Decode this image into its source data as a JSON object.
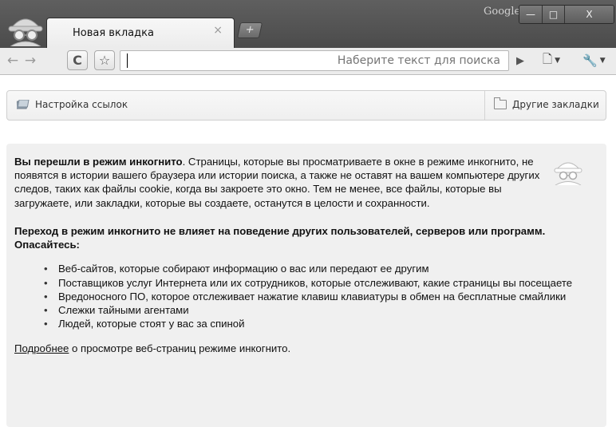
{
  "tab": {
    "title": "Новая вкладка",
    "close_glyph": "×",
    "newtab_glyph": "+"
  },
  "titlebar": {
    "brand": "Google",
    "min_glyph": "—",
    "max_glyph": "□",
    "close_glyph": "X"
  },
  "toolbar": {
    "back_glyph": "←",
    "forward_glyph": "→",
    "reload_glyph": "C",
    "star_glyph": "☆",
    "omnibox_placeholder": "Наберите текст для поиска",
    "go_glyph": "▶",
    "page_glyph": "🗋",
    "tools_glyph": "🔧",
    "dropdown_glyph": "▼"
  },
  "bookmarks": {
    "setup_label": "Настройка ссылок",
    "other_label": "Другие закладки"
  },
  "content": {
    "intro_bold": "Вы перешли в режим инкогнито",
    "intro_text": ". Страницы, которые вы просматриваете в окне в режиме инкогнито, не появятся в истории вашего браузера или истории поиска, а также не оставят на вашем компьютере других следов, таких как файлы cookie, когда вы закроете это окно. Тем не менее, все файлы, которые вы загружаете, или закладки, которые вы создаете, останутся в целости и сохранности.",
    "warning_heading": "Переход в режим инкогнито не влияет на поведение других пользователей, серверов или программ. Опасайтесь:",
    "threats": [
      "Веб-сайтов, которые собирают информацию о вас или передают ее другим",
      "Поставщиков услуг Интернета или их сотрудников, которые отслеживают, какие страницы вы посещаете",
      "Вредоносного ПО, которое отслеживает нажатие клавиш клавиатуры в обмен на бесплатные смайлики",
      "Слежки тайными агентами",
      "Людей, которые стоят у вас за спиной"
    ],
    "more_link": "Подробнее",
    "more_text": " о просмотре веб-страниц режиме инкогнито."
  },
  "colors": {
    "titlebar": "#555555",
    "toolbar": "#ececec",
    "content_bg": "#f0f0f0"
  },
  "icons": [
    "incognito-icon",
    "back-icon",
    "forward-icon",
    "reload-icon",
    "star-icon",
    "go-icon",
    "page-icon",
    "wrench-icon",
    "bookmark-icon",
    "folder-icon",
    "spy-icon"
  ]
}
